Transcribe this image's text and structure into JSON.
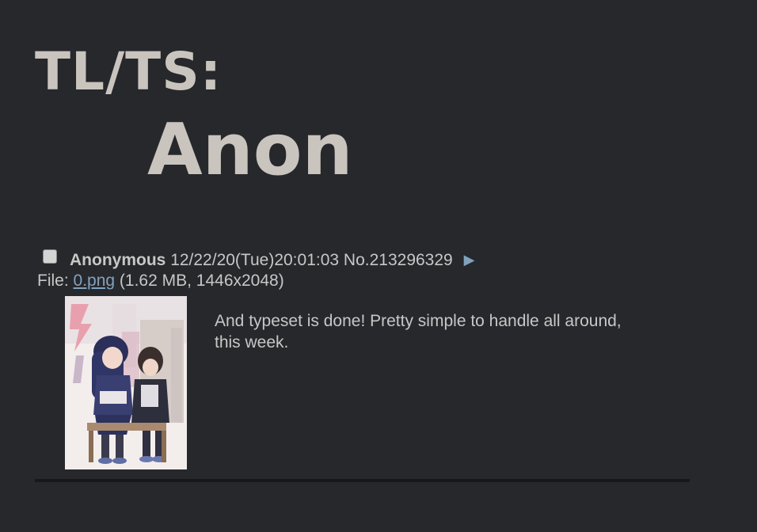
{
  "credit": {
    "role": "TL/TS:",
    "name": "Anon"
  },
  "post": {
    "name": "Anonymous",
    "datetime": "12/22/20(Tue)20:01:03",
    "number": "No.213296329",
    "menu_icon": "triangle-right-icon",
    "file": {
      "prefix": "File: ",
      "filename": "0.png",
      "info": " (1.62 MB, 1446x2048)"
    },
    "message": "And typeset is done! Pretty simple to handle all around, this week."
  },
  "colors": {
    "background": "#27282c",
    "text": "#c5c8c6",
    "link": "#81a2be",
    "credit_text": "#c9c4bd",
    "divider": "#17181a"
  }
}
